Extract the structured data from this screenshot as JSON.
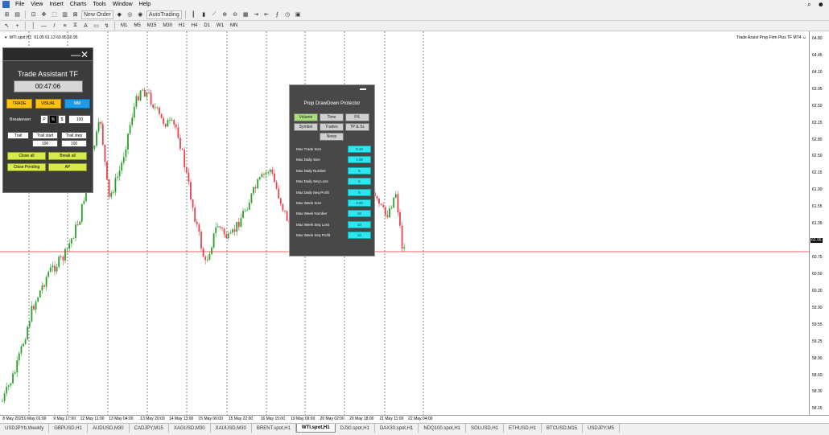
{
  "menu": {
    "items": [
      "File",
      "View",
      "Insert",
      "Charts",
      "Tools",
      "Window",
      "Help"
    ]
  },
  "toolbar": {
    "new_order": "New Order",
    "autotrading": "AutoTrading",
    "timeframes": [
      "M1",
      "M5",
      "M15",
      "M30",
      "H1",
      "H4",
      "D1",
      "W1",
      "MN"
    ]
  },
  "chart": {
    "symbol_info": "WTI.spot,H1",
    "ohlc": "61.05 61.13 60.95 60.95",
    "indicator": "Trade Assist Prop Firm Plus TF MT4",
    "current_price": "60.95",
    "time_labels": [
      "8 May 2025",
      "9 May 01:00",
      "9 May 17:00",
      "12 May 11:00",
      "13 May 04:00",
      "13 May 20:00",
      "14 May 13:00",
      "15 May 06:00",
      "15 May 22:00",
      "16 May 15:00",
      "19 May 09:00",
      "20 May 02:00",
      "20 May 18:00",
      "21 May 11:00",
      "22 May 04:00"
    ],
    "price_labels": [
      "64.80",
      "64.45",
      "64.10",
      "63.95",
      "63.50",
      "63.15",
      "62.80",
      "62.50",
      "62.15",
      "61.90",
      "61.55",
      "61.35",
      "60.95",
      "60.75",
      "60.50",
      "60.20",
      "59.90",
      "59.55",
      "59.25",
      "58.90",
      "58.60",
      "58.30",
      "58.15"
    ]
  },
  "trade_assistant": {
    "title": "Trade Assistant TF",
    "timer": "00:47:06",
    "trade": "TRADE",
    "visual": "VISUAL",
    "mm": "MM",
    "breakeven": "Breakeven",
    "p": "P",
    "pct": "%",
    "dollar": "$",
    "be_value": "100",
    "trail": "Trail",
    "trail_start": "Trail start",
    "trail_step": "Trail step",
    "trail_start_value": "100",
    "trail_step_value": "100",
    "close_all": "Close all",
    "break_all": "Break all",
    "close_pending": "Close Pending",
    "ap": "AP",
    "controls": "—✕"
  },
  "prop": {
    "title": "Prop DrawDown Protector",
    "tabs": [
      "Volume",
      "Time",
      "P/L",
      "Symbol",
      "Trades",
      "TP & SL",
      "News"
    ],
    "rows": [
      {
        "label": "Max Trade Size",
        "value": "0.10"
      },
      {
        "label": "Max Daily Size",
        "value": "1.00"
      },
      {
        "label": "Max Daily Number",
        "value": "5"
      },
      {
        "label": "Max Daily Seq Loss",
        "value": "5"
      },
      {
        "label": "Max Daily Seq Profit",
        "value": "5"
      },
      {
        "label": "Max Week Size",
        "value": "3.00"
      },
      {
        "label": "Max Week Number",
        "value": "10"
      },
      {
        "label": "Max Week Seq Loss",
        "value": "10"
      },
      {
        "label": "Max Week Seq Profit",
        "value": "10"
      }
    ]
  },
  "tabs": [
    "USDJPYb,Weekly",
    "GBPUSD,H1",
    "AUDUSD,M30",
    "CADJPY,M15",
    "XAGUSD,M30",
    "XAUUSD,M30",
    "BRENT.spot,H1",
    "WTI.spot,H1",
    "DJ30.spot,H1",
    "DAX30.spot,H1",
    "NDQ100.spot,H1",
    "SOLUSD,H1",
    "ETHUSD,H1",
    "BTCUSD,M15",
    "USDJPY,M5"
  ],
  "active_tab": "WTI.spot,H1",
  "colors": {
    "bull": "#2ca02c",
    "bear": "#e8424a",
    "price_line": "#e03030"
  }
}
